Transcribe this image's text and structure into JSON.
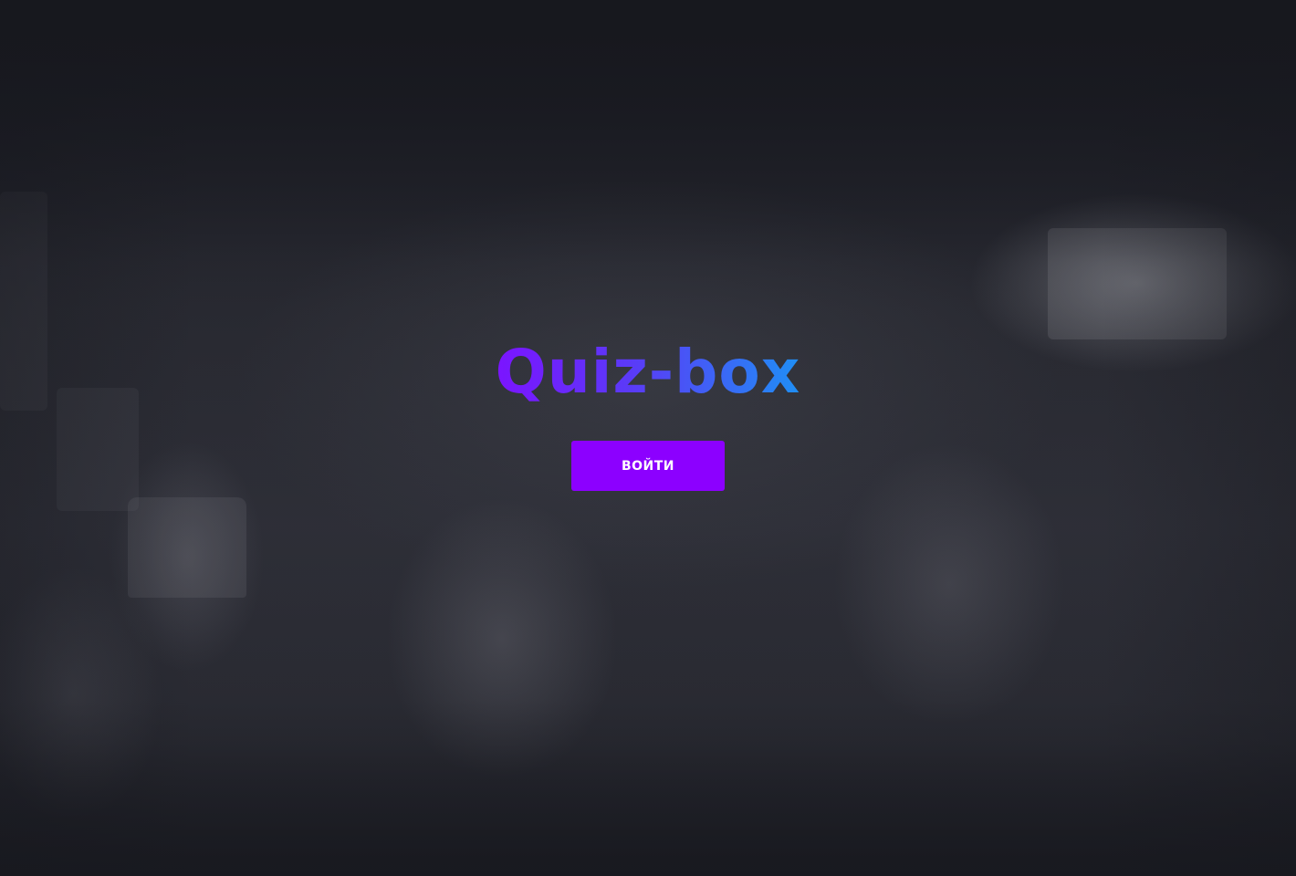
{
  "hero": {
    "logo_text": "Quiz-box",
    "login_label": "ВОЙТИ"
  },
  "colors": {
    "background": "#1a1b22",
    "logo_gradient_start": "#7b14ff",
    "logo_gradient_end": "#1f8ff5",
    "button_background": "#8c00ff",
    "button_text": "#ffffff"
  }
}
